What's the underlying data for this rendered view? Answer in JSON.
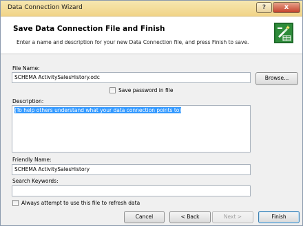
{
  "window": {
    "title": "Data Connection Wizard",
    "help_glyph": "?",
    "close_glyph": "x"
  },
  "header": {
    "title": "Save Data Connection File and Finish",
    "description": "Enter a name and description for your new Data Connection file, and press Finish to save.",
    "icon": "wizard-connection-icon"
  },
  "form": {
    "file_name_label": "File Name:",
    "file_name_value": "SCHEMA ActivitySalesHistory.odc",
    "browse_label": "Browse...",
    "save_password_label": "Save password in file",
    "save_password_checked": false,
    "description_label": "Description:",
    "description_value": "(To help others understand what your data connection points to)",
    "friendly_name_label": "Friendly Name:",
    "friendly_name_value": "SCHEMA ActivitySalesHistory",
    "search_keywords_label": "Search Keywords:",
    "search_keywords_value": "",
    "always_attempt_label": "Always attempt to use this file to refresh data",
    "always_attempt_checked": false
  },
  "buttons": {
    "cancel": "Cancel",
    "back": "< Back",
    "next": "Next >",
    "finish": "Finish"
  }
}
